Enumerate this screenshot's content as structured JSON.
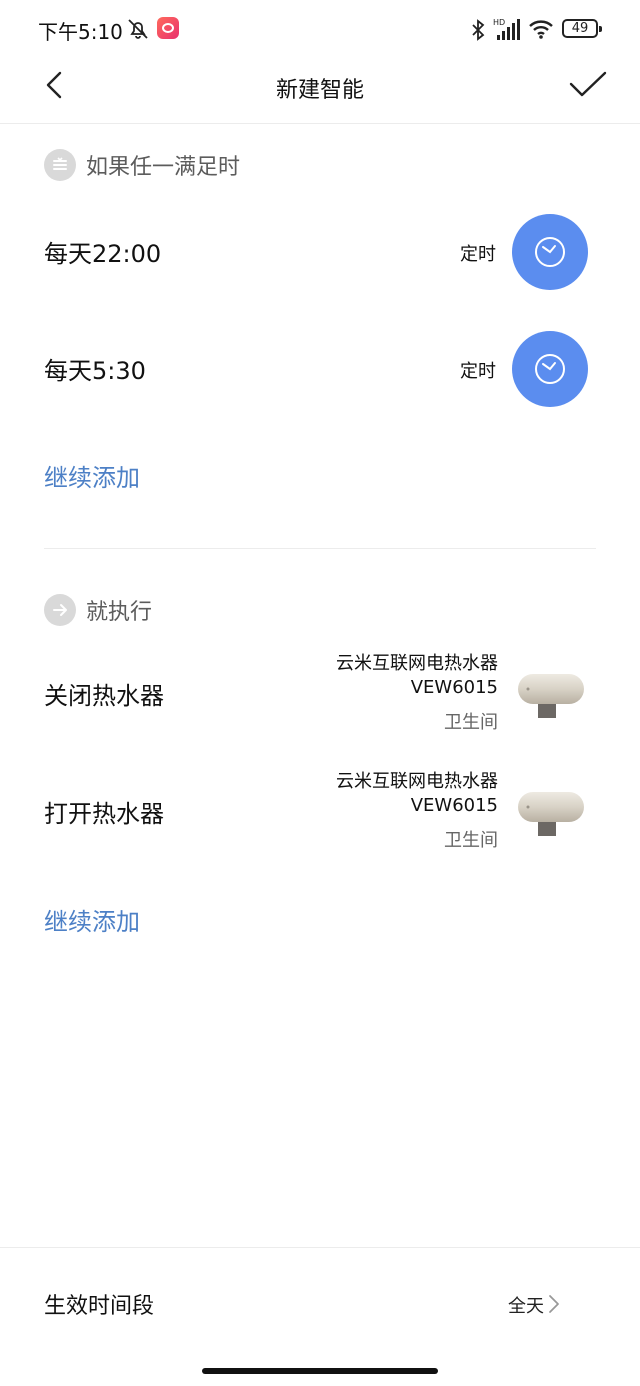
{
  "status_bar": {
    "time": "下午5:10",
    "battery": "49",
    "icons": [
      "mute-icon",
      "app-badge-icon",
      "bluetooth-icon",
      "signal-icon",
      "wifi-icon",
      "battery-icon"
    ]
  },
  "header": {
    "title": "新建智能",
    "back_icon": "chevron-left-icon",
    "confirm_icon": "checkmark-icon"
  },
  "if_section": {
    "title": "如果任一满足时",
    "conditions": [
      {
        "label": "每天22:00",
        "type": "定时"
      },
      {
        "label": "每天5:30",
        "type": "定时"
      }
    ],
    "add_label": "继续添加"
  },
  "then_section": {
    "title": "就执行",
    "actions": [
      {
        "label": "关闭热水器",
        "device": "云米互联网电热水器",
        "model": "VEW6015",
        "room": "卫生间"
      },
      {
        "label": "打开热水器",
        "device": "云米互联网电热水器",
        "model": "VEW6015",
        "room": "卫生间"
      }
    ],
    "add_label": "继续添加"
  },
  "period": {
    "label": "生效时间段",
    "value": "全天"
  },
  "colors": {
    "accent_blue": "#5b8def",
    "link_blue": "#4d80c6",
    "section_grey": "#d9d9d9"
  }
}
